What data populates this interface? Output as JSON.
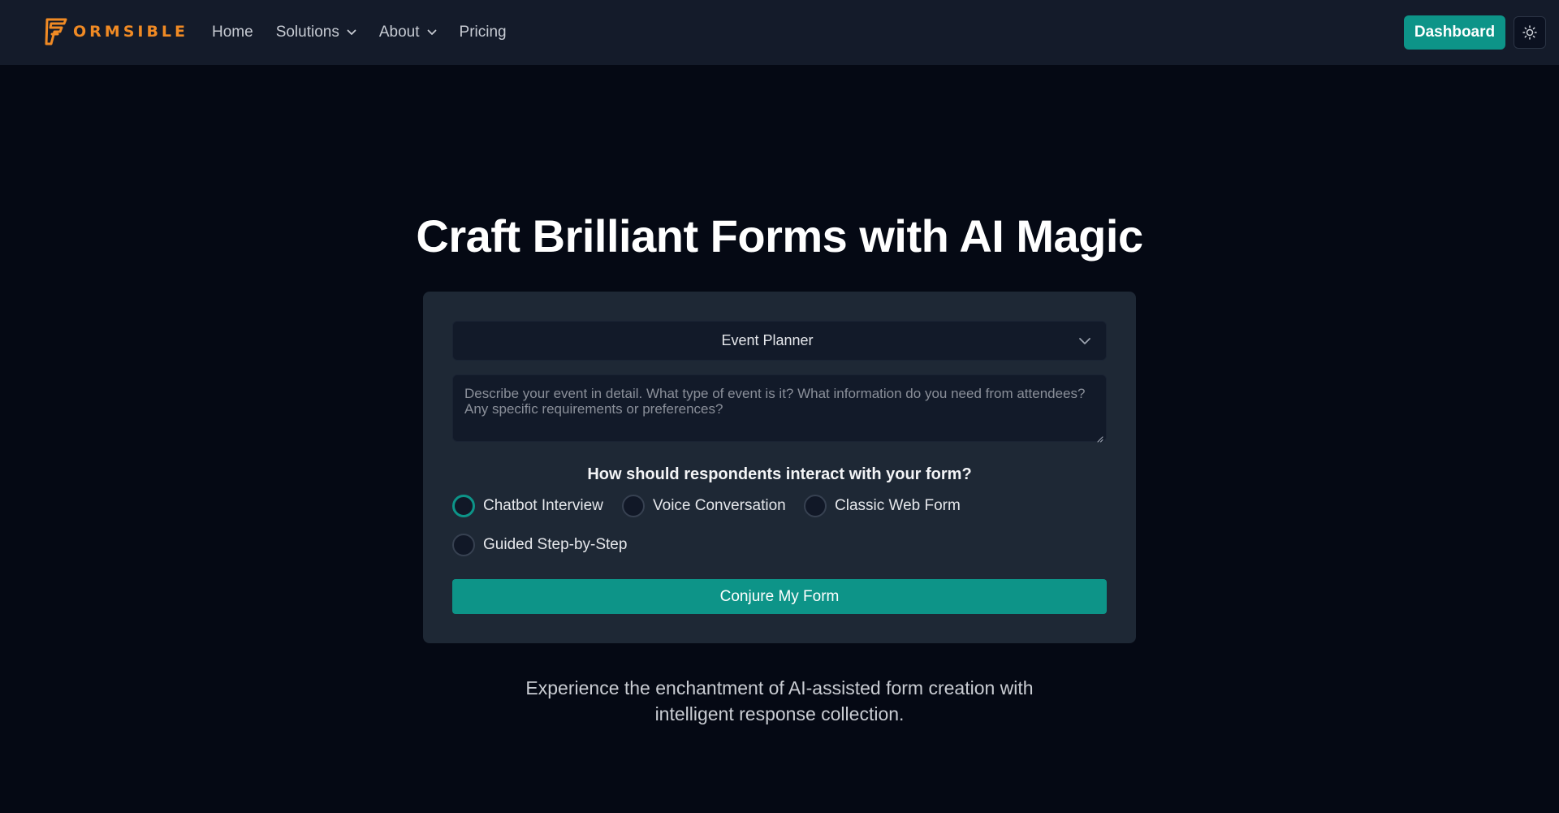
{
  "brand": {
    "name": "ORMSIBLE",
    "color": "#f08a24"
  },
  "nav": {
    "items": [
      {
        "label": "Home",
        "has_dropdown": false
      },
      {
        "label": "Solutions",
        "has_dropdown": true
      },
      {
        "label": "About",
        "has_dropdown": true
      },
      {
        "label": "Pricing",
        "has_dropdown": false
      }
    ]
  },
  "header": {
    "dashboard_label": "Dashboard",
    "theme_toggle_icon": "sun-icon"
  },
  "hero": {
    "title": "Craft Brilliant Forms with AI Magic",
    "tagline_line1": "Experience the enchantment of AI-assisted form creation with",
    "tagline_line2": "intelligent response collection."
  },
  "form": {
    "template_select": {
      "value": "Event Planner",
      "icon": "chevron-down-icon"
    },
    "description": {
      "value": "",
      "placeholder": "Describe your event in detail. What type of event is it? What information do you need from attendees? Any specific requirements or preferences?"
    },
    "question": "How should respondents interact with your form?",
    "options": [
      {
        "label": "Chatbot Interview",
        "checked": true
      },
      {
        "label": "Voice Conversation",
        "checked": false
      },
      {
        "label": "Classic Web Form",
        "checked": false
      },
      {
        "label": "Guided Step-by-Step",
        "checked": false
      }
    ],
    "submit_label": "Conjure My Form"
  },
  "colors": {
    "accent": "#0d9488",
    "background": "#050914",
    "header": "#141b2a",
    "card": "#1e2835"
  }
}
